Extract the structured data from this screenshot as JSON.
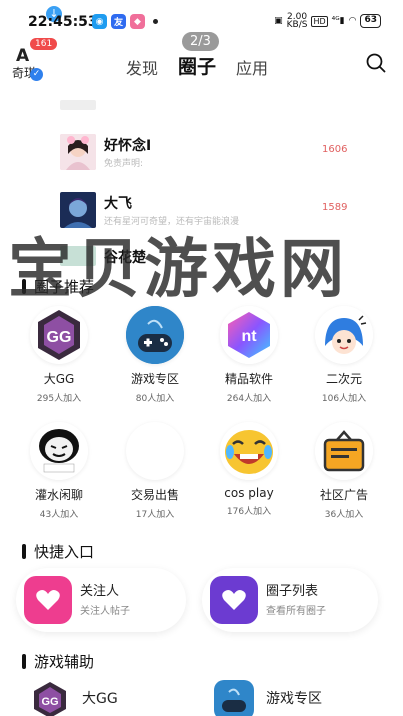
{
  "status_bar": {
    "time": "22:45:53",
    "net_speed": "2.00\nKB/S",
    "hd": "HD",
    "battery": "63",
    "icon_labels": [
      "友"
    ]
  },
  "header": {
    "app_name": "奇琪",
    "notification_count": "161",
    "tabs": [
      {
        "label": "发现",
        "active": false
      },
      {
        "label": "圈子",
        "active": true
      },
      {
        "label": "应用",
        "active": false
      }
    ],
    "page_indicator": "2/3"
  },
  "ranking": [
    {
      "name": "好怀念I",
      "desc": "免责声明:",
      "score": "1606"
    },
    {
      "name": "大飞",
      "desc": "还有星河可奇望，还有宇宙能浪漫",
      "score": "1589"
    },
    {
      "name": "谷花楚",
      "desc": "",
      "score": ""
    }
  ],
  "sections": {
    "recommend_title": "圈子推荐",
    "quick_title": "快捷入口",
    "game_title": "游戏辅助"
  },
  "circles": [
    {
      "name": "大GG",
      "count": "295人加入"
    },
    {
      "name": "游戏专区",
      "count": "80人加入"
    },
    {
      "name": "精品软件",
      "count": "264人加入"
    },
    {
      "name": "二次元",
      "count": "106人加入"
    },
    {
      "name": "灌水闲聊",
      "count": "43人加入"
    },
    {
      "name": "交易出售",
      "count": "17人加入"
    },
    {
      "name": "cos play",
      "count": "176人加入"
    },
    {
      "name": "社区广告",
      "count": "36人加入"
    }
  ],
  "quick_entries": [
    {
      "title": "关注人",
      "subtitle": "关注人帖子",
      "color": "#ee3d8f"
    },
    {
      "title": "圈子列表",
      "subtitle": "查看所有圈子",
      "color": "#6c3bd1"
    }
  ],
  "game_items": [
    {
      "name": "大GG"
    },
    {
      "name": "游戏专区"
    }
  ],
  "watermark": "宝贝游戏网",
  "colors": {
    "accent": "#2f80ed",
    "score": "#e06060",
    "badge": "#f04a4a"
  }
}
